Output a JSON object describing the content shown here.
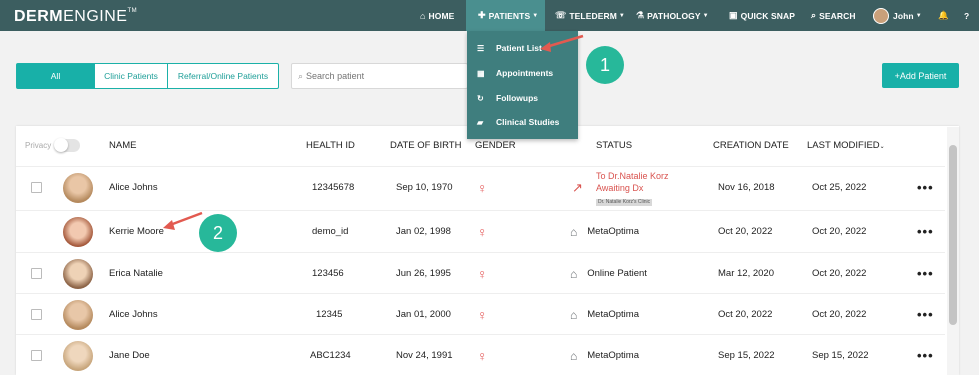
{
  "logo": {
    "bold": "DERM",
    "light": "ENGINE",
    "tm": "TM"
  },
  "nav": {
    "home": "HOME",
    "patients": "PATIENTS",
    "telederm": "TELEDERM",
    "pathology": "PATHOLOGY",
    "quick_snap": "QUICK SNAP",
    "search": "SEARCH",
    "user": "John",
    "help": "?"
  },
  "patients_menu": {
    "items": [
      "Patient List",
      "Appointments",
      "Followups",
      "Clinical Studies"
    ]
  },
  "filters": {
    "tabs": [
      "All",
      "Clinic Patients",
      "Referral/Online Patients"
    ],
    "active_tab": "All",
    "search_placeholder": "Search patient",
    "add_button": "Add Patient"
  },
  "table": {
    "privacy_label": "Privacy",
    "headers": {
      "name": "NAME",
      "health_id": "HEALTH ID",
      "dob": "DATE OF BIRTH",
      "gender": "GENDER",
      "status": "STATUS",
      "creation_date": "CREATION DATE",
      "last_modified": "LAST MODIFIED"
    },
    "rows": [
      {
        "name": "Alice Johns",
        "health_id": "12345678",
        "dob": "Sep 10, 1970",
        "status_line1": "To Dr.Natalie Korz",
        "status_line2": "Awaiting Dx",
        "status_tag": "Dr. Natalie Korz's Clinic",
        "created": "Nov 16, 2018",
        "modified": "Oct 25, 2022"
      },
      {
        "name": "Kerrie Moore",
        "health_id": "demo_id",
        "dob": "Jan 02, 1998",
        "status": "MetaOptima",
        "created": "Oct 20, 2022",
        "modified": "Oct 20, 2022"
      },
      {
        "name": "Erica Natalie",
        "health_id": "123456",
        "dob": "Jun 26, 1995",
        "status": "Online Patient",
        "created": "Mar 12, 2020",
        "modified": "Oct 20, 2022"
      },
      {
        "name": "Alice Johns",
        "health_id": "12345",
        "dob": "Jan 01, 2000",
        "status": "MetaOptima",
        "created": "Oct 20, 2022",
        "modified": "Oct 20, 2022"
      },
      {
        "name": "Jane Doe",
        "health_id": "ABC1234",
        "dob": "Nov 24, 1991",
        "status": "MetaOptima",
        "created": "Sep 15, 2022",
        "modified": "Sep 15, 2022"
      }
    ],
    "more": "•••"
  },
  "annotations": {
    "step1": "1",
    "step2": "2"
  },
  "colors": {
    "topbar": "#3c5e60",
    "accent": "#18b0a8",
    "annotation": "#27b89a",
    "arrow": "#e25a50",
    "referral": "#d9534f"
  }
}
